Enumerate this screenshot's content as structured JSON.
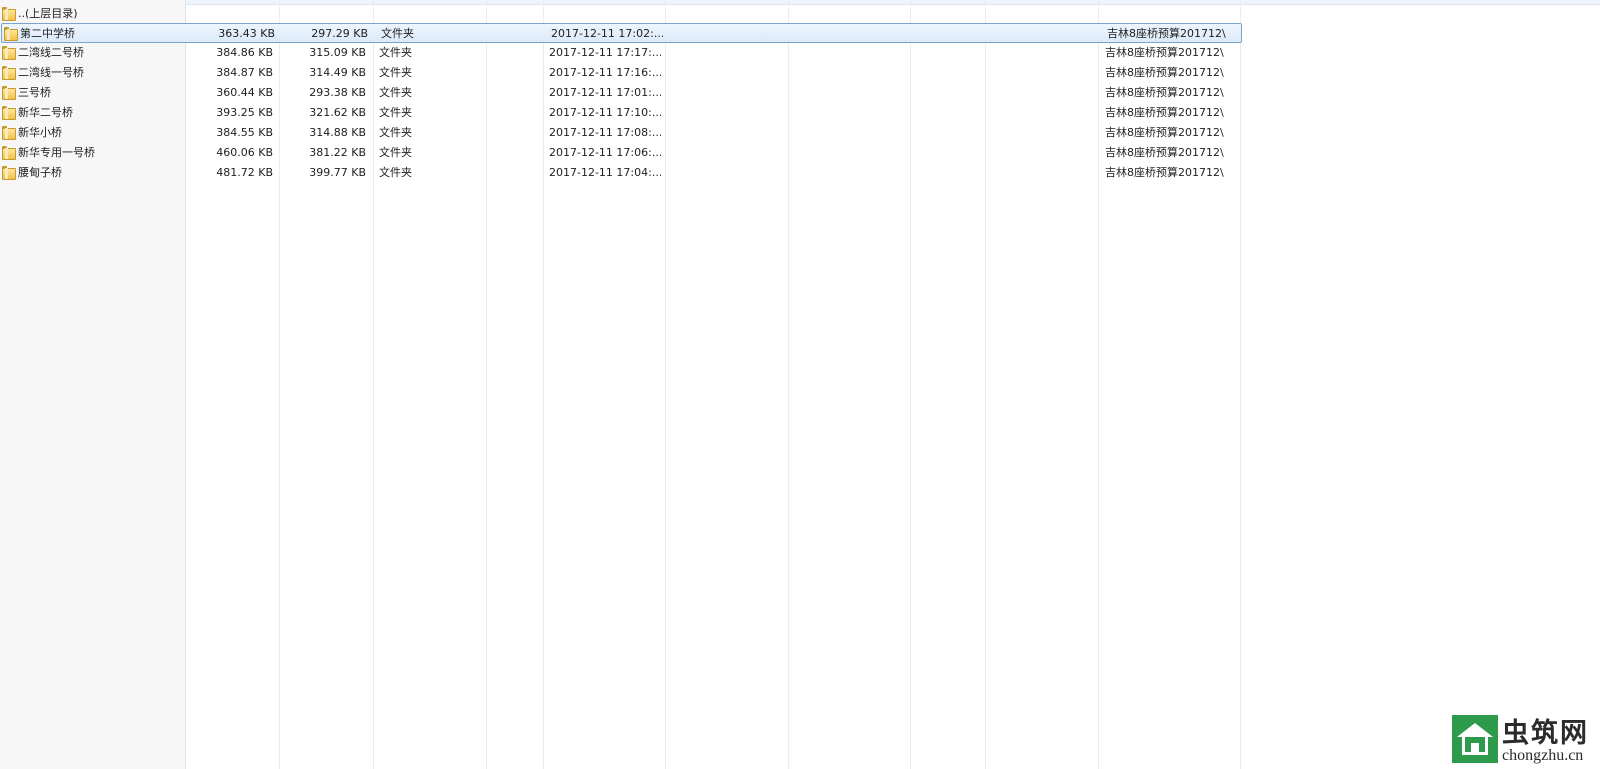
{
  "parent_row": {
    "label": "..(上层目录)",
    "icon": "folder-icon"
  },
  "rows": [
    {
      "name": "第二中学桥",
      "size": "363.43 KB",
      "packed": "297.29 KB",
      "type": "文件夹",
      "modified": "2017-12-11 17:02:...",
      "path": "吉林8座桥预算201712\\",
      "selected": true
    },
    {
      "name": "二湾线二号桥",
      "size": "384.86 KB",
      "packed": "315.09 KB",
      "type": "文件夹",
      "modified": "2017-12-11 17:17:...",
      "path": "吉林8座桥预算201712\\",
      "selected": false
    },
    {
      "name": "二湾线一号桥",
      "size": "384.87 KB",
      "packed": "314.49 KB",
      "type": "文件夹",
      "modified": "2017-12-11 17:16:...",
      "path": "吉林8座桥预算201712\\",
      "selected": false
    },
    {
      "name": "三号桥",
      "size": "360.44 KB",
      "packed": "293.38 KB",
      "type": "文件夹",
      "modified": "2017-12-11 17:01:...",
      "path": "吉林8座桥预算201712\\",
      "selected": false
    },
    {
      "name": "新华二号桥",
      "size": "393.25 KB",
      "packed": "321.62 KB",
      "type": "文件夹",
      "modified": "2017-12-11 17:10:...",
      "path": "吉林8座桥预算201712\\",
      "selected": false
    },
    {
      "name": "新华小桥",
      "size": "384.55 KB",
      "packed": "314.88 KB",
      "type": "文件夹",
      "modified": "2017-12-11 17:08:...",
      "path": "吉林8座桥预算201712\\",
      "selected": false
    },
    {
      "name": "新华专用一号桥",
      "size": "460.06 KB",
      "packed": "381.22 KB",
      "type": "文件夹",
      "modified": "2017-12-11 17:06:...",
      "path": "吉林8座桥预算201712\\",
      "selected": false
    },
    {
      "name": "腰甸子桥",
      "size": "481.72 KB",
      "packed": "399.77 KB",
      "type": "文件夹",
      "modified": "2017-12-11 17:04:...",
      "path": "吉林8座桥预算201712\\",
      "selected": false
    }
  ],
  "watermark": {
    "cn": "虫筑网",
    "en": "chongzhu.cn",
    "logo_color": "#2e9b4c"
  },
  "colors": {
    "selection_border": "#7da2ce",
    "selection_fill": "#dceaf9",
    "folder": "#f3c24a"
  }
}
